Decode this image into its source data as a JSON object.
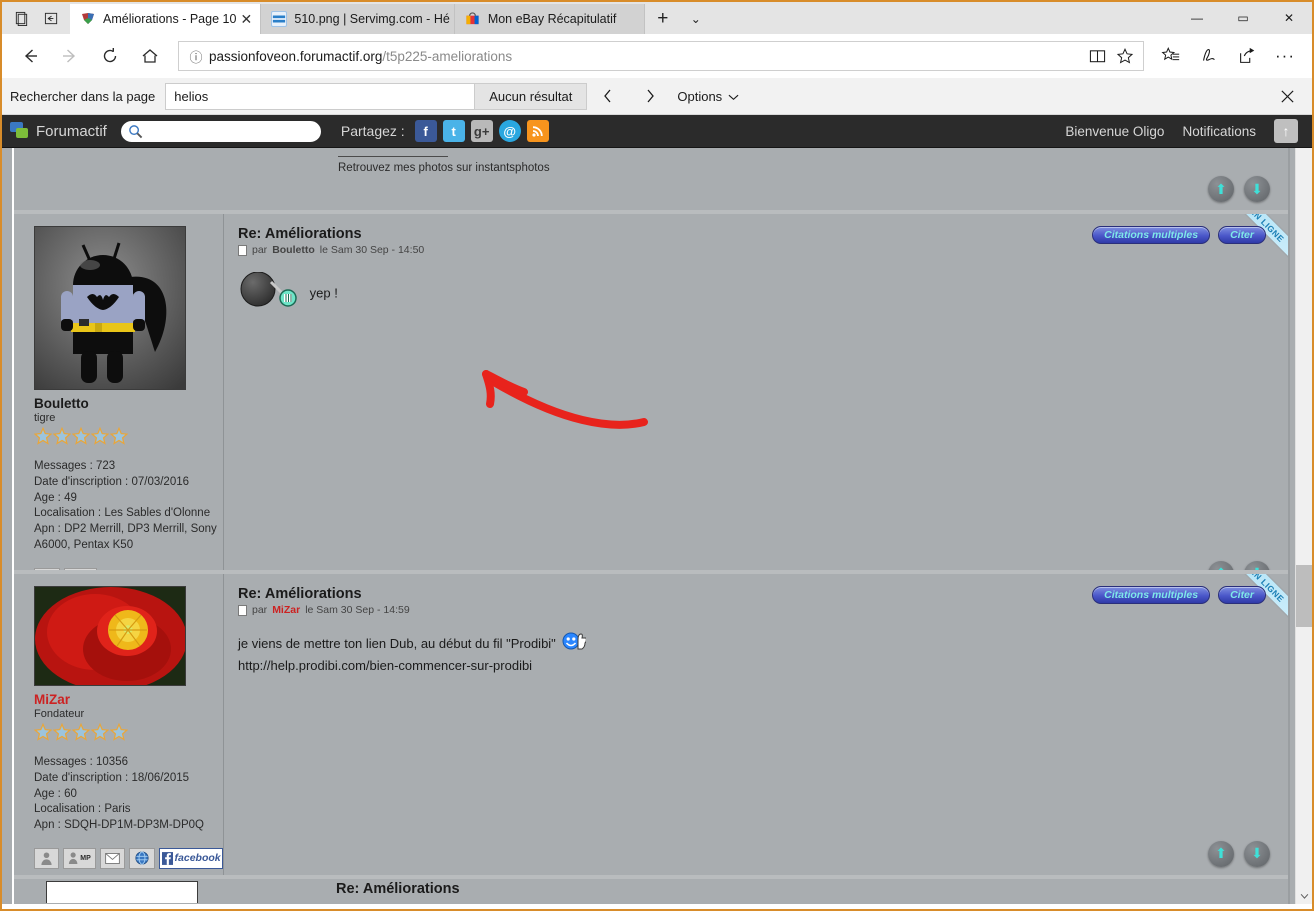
{
  "browser": {
    "tabs": [
      {
        "title": "Améliorations - Page 10",
        "favicon": "forumactif-icon",
        "active": true
      },
      {
        "title": "510.png | Servimg.com - Hé",
        "favicon": "servimg-icon",
        "active": false
      },
      {
        "title": "Mon eBay Récapitulatif",
        "favicon": "ebay-icon",
        "active": false
      }
    ],
    "new_tab_label": "+",
    "tab_list_label": "⌄",
    "window_controls": {
      "minimize": "—",
      "maximize": "▭",
      "close": "✕"
    },
    "nav": {
      "back": "←",
      "forward": "→",
      "refresh": "⟳",
      "home": "⌂",
      "info_icon": "ⓘ",
      "url_domain": "passionfoveon.forumactif.org",
      "url_path": "/t5p225-ameliorations",
      "reading_view": "book-icon",
      "favorite": "star-icon",
      "hub": "hub-icon",
      "notes": "note-icon",
      "share": "share-icon",
      "more": "···"
    },
    "findbar": {
      "label": "Rechercher dans la page",
      "value": "helios",
      "placeholder": "",
      "result": "Aucun résultat",
      "prev": "‹",
      "next": "›",
      "options_label": "Options",
      "options_caret": "⌄",
      "close": "✕"
    }
  },
  "forum_bar": {
    "brand": "Forumactif",
    "search_value": "",
    "search_placeholder": "",
    "share_label": "Partagez :",
    "socials": [
      {
        "name": "facebook-icon",
        "glyph": "f"
      },
      {
        "name": "twitter-icon",
        "glyph": "t"
      },
      {
        "name": "googleplus-icon",
        "glyph": "g+"
      },
      {
        "name": "email-icon",
        "glyph": "@"
      },
      {
        "name": "rss-icon",
        "glyph": "≫"
      }
    ],
    "welcome": "Bienvenue Oligo",
    "notifications": "Notifications",
    "collapse": "↑"
  },
  "top_partial": {
    "signature_text": "Retrouvez mes photos sur instantsphotos"
  },
  "posts": [
    {
      "title": "Re: Améliorations",
      "meta_prefix": "par",
      "author": "Bouletto",
      "author_color": "#1b1b1b",
      "meta_suffix": "le Sam 30 Sep - 14:50",
      "body_lines": [
        "yep !"
      ],
      "has_ball_smiley": true,
      "buttons": {
        "multiquote": "Citations multiples",
        "quote": "Citer"
      },
      "ribbon": "EN LIGNE",
      "user": {
        "name": "Bouletto",
        "name_color": "#1b1b1b",
        "rank": "tigre",
        "stars": 5,
        "avatar": "batman-android-avatar",
        "fields": [
          {
            "label": "Messages",
            "value": "723"
          },
          {
            "label": "Date d'inscription",
            "value": "07/03/2016"
          },
          {
            "label": "Age",
            "value": "49"
          },
          {
            "label": "Localisation",
            "value": "Les Sables d'Olonne"
          },
          {
            "label": "Apn",
            "value": "DP2 Merrill, DP3 Merrill, Sony A6000, Pentax K50"
          }
        ],
        "buttons": [
          "profile-icon",
          "pm-icon"
        ]
      }
    },
    {
      "title": "Re: Améliorations",
      "meta_prefix": "par",
      "author": "MiZar",
      "author_color": "#cc2222",
      "meta_suffix": "le Sam 30 Sep - 14:59",
      "body_lines": [
        "je viens de mettre ton lien Dub, au début du fil \"Prodibi\"",
        "http://help.prodibi.com/bien-commencer-sur-prodibi"
      ],
      "has_thumbup_smiley": true,
      "buttons": {
        "multiquote": "Citations multiples",
        "quote": "Citer"
      },
      "ribbon": "EN LIGNE",
      "user": {
        "name": "MiZar",
        "name_color": "#cc2222",
        "rank": "Fondateur",
        "stars": 5,
        "avatar": "red-poppy-avatar",
        "fields": [
          {
            "label": "Messages",
            "value": "10356"
          },
          {
            "label": "Date d'inscription",
            "value": "18/06/2015"
          },
          {
            "label": "Age",
            "value": "60"
          },
          {
            "label": "Localisation",
            "value": "Paris"
          },
          {
            "label": "Apn",
            "value": "SDQH-DP1M-DP3M-DP0Q"
          }
        ],
        "buttons": [
          "profile-icon",
          "pm-icon",
          "email-icon",
          "website-icon"
        ],
        "facebook_label": "facebook"
      }
    }
  ],
  "bottom_partial": {
    "title": "Re: Améliorations"
  },
  "nav_arrows": {
    "up": "⬆",
    "down": "⬇"
  },
  "colors": {
    "page_bg": "#a9adb0",
    "forum_bar_bg": "#2b2b2b",
    "accent_red": "#cc2222",
    "pill_text": "#7fe8e8",
    "window_border": "#d88c2a"
  }
}
